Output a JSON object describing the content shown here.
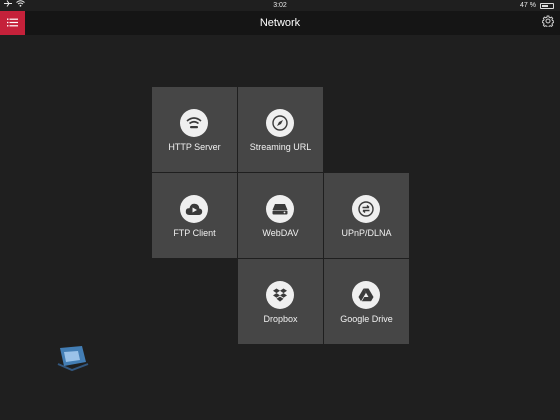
{
  "status_bar": {
    "time": "3:02",
    "battery": "47 %"
  },
  "nav": {
    "title": "Network"
  },
  "tiles": [
    {
      "label": "HTTP Server",
      "icon": "wifi-icon"
    },
    {
      "label": "Streaming URL",
      "icon": "compass-icon"
    },
    {
      "label": "FTP Client",
      "icon": "cloud-play-icon"
    },
    {
      "label": "WebDAV",
      "icon": "drive-icon"
    },
    {
      "label": "UPnP/DLNA",
      "icon": "sync-icon"
    },
    {
      "label": "Dropbox",
      "icon": "dropbox-icon"
    },
    {
      "label": "Google Drive",
      "icon": "google-drive-icon"
    }
  ],
  "colors": {
    "background": "#1f1f1f",
    "navbar": "#151515",
    "accent": "#c5213a",
    "tile": "#464646"
  }
}
